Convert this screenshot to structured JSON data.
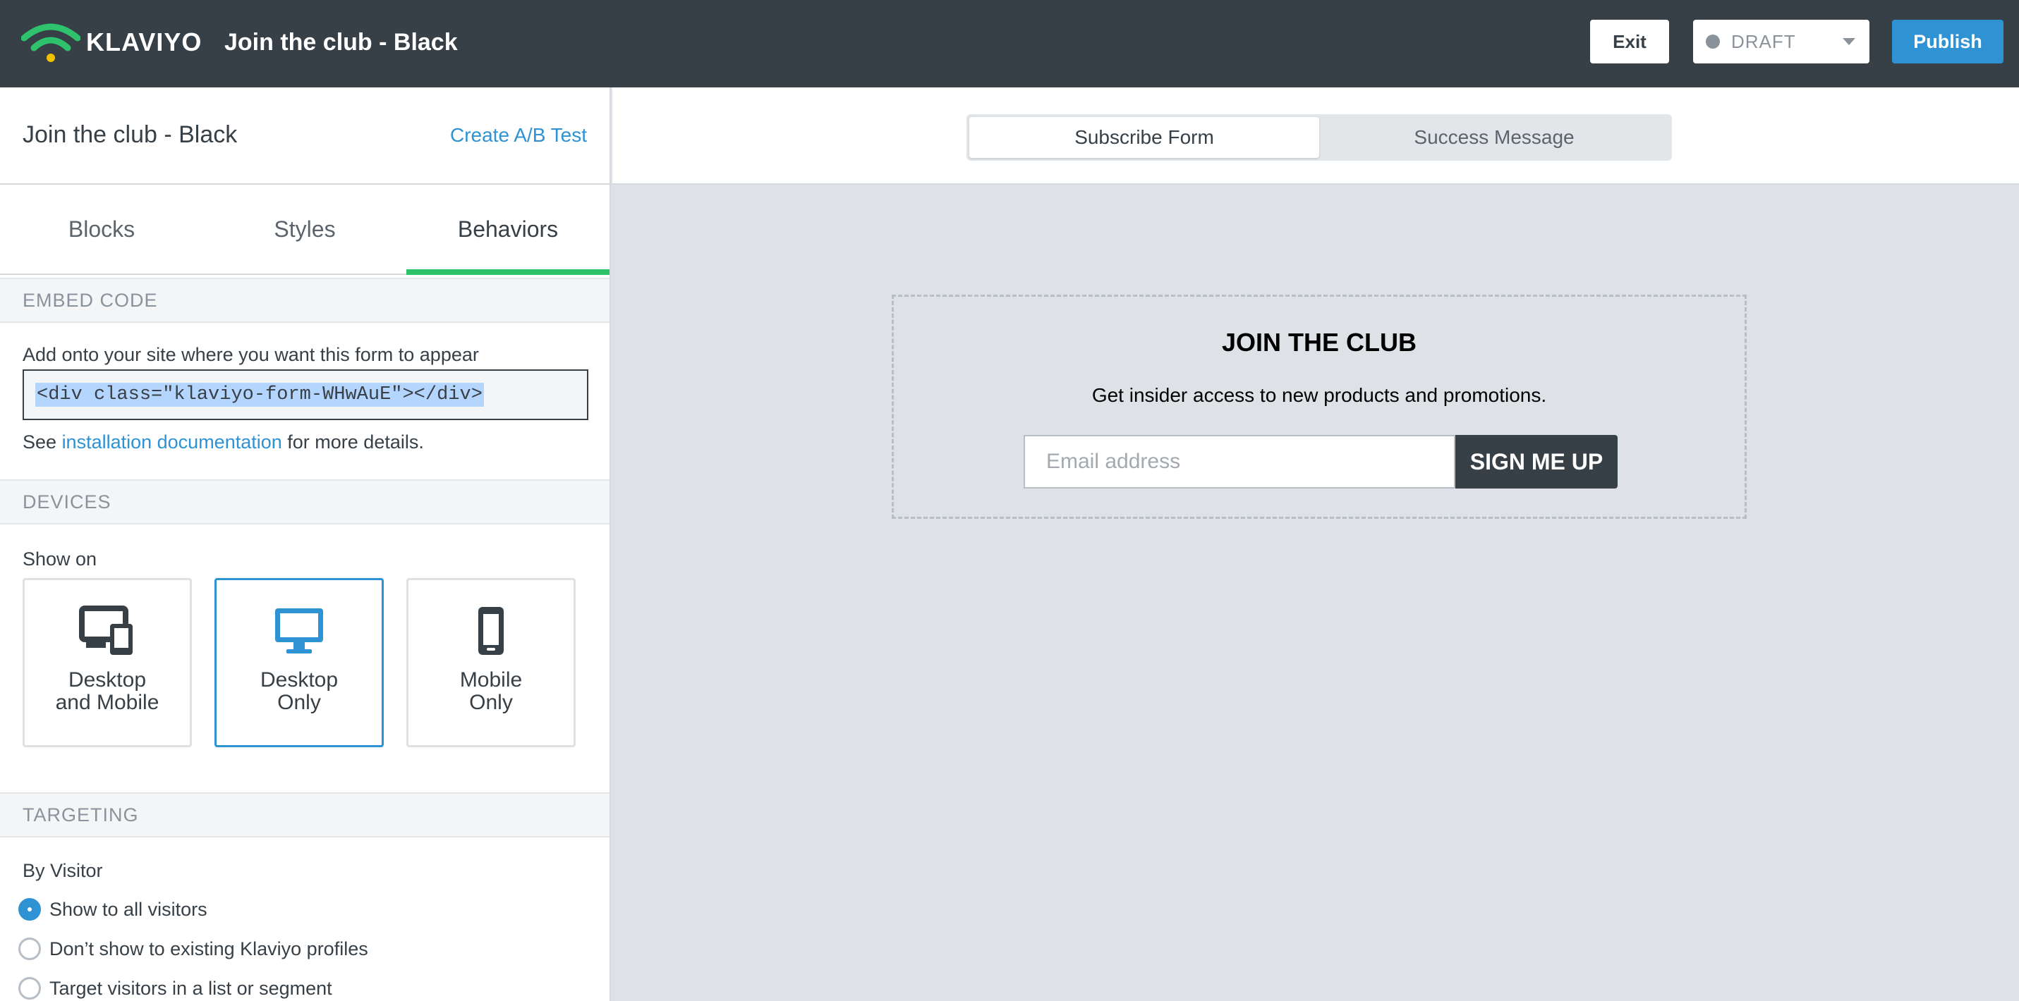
{
  "app": {
    "brand": "KLAVIYO",
    "title": "Join the club - Black",
    "exit_label": "Exit",
    "status": "DRAFT",
    "publish_label": "Publish",
    "colors": {
      "topbar": "#373f47",
      "accent": "#2e92d3",
      "tab_indicator": "#2dc26b"
    }
  },
  "sidebar": {
    "form_name": "Join the club - Black",
    "ab_test_link": "Create A/B Test",
    "tabs": [
      {
        "label": "Blocks",
        "active": false
      },
      {
        "label": "Styles",
        "active": false
      },
      {
        "label": "Behaviors",
        "active": true
      }
    ],
    "embed": {
      "header": "EMBED CODE",
      "instruction": "Add onto your site where you want this form to appear",
      "code": "<div class=\"klaviyo-form-WHwAuE\"></div>",
      "see_prefix": "See",
      "doc_link": "installation documentation",
      "see_suffix": "for more details."
    },
    "devices": {
      "header": "DEVICES",
      "show_on_label": "Show on",
      "options": [
        {
          "line1": "Desktop",
          "line2": "and Mobile",
          "icon": "desktop-and-mobile-icon",
          "selected": false
        },
        {
          "line1": "Desktop",
          "line2": "Only",
          "icon": "desktop-icon",
          "selected": true
        },
        {
          "line1": "Mobile",
          "line2": "Only",
          "icon": "mobile-icon",
          "selected": false
        }
      ]
    },
    "targeting": {
      "header": "TARGETING",
      "by_visitor_label": "By Visitor",
      "options": [
        {
          "label": "Show to all visitors",
          "checked": true
        },
        {
          "label": "Don’t show to existing Klaviyo profiles",
          "checked": false
        },
        {
          "label": "Target visitors in a list or segment",
          "checked": false
        }
      ]
    }
  },
  "preview": {
    "toggle": [
      {
        "label": "Subscribe Form",
        "active": true
      },
      {
        "label": "Success Message",
        "active": false
      }
    ],
    "form": {
      "title": "JOIN THE CLUB",
      "subtitle": "Get insider access to new products and promotions.",
      "email_placeholder": "Email address",
      "button_label": "SIGN ME UP"
    }
  }
}
